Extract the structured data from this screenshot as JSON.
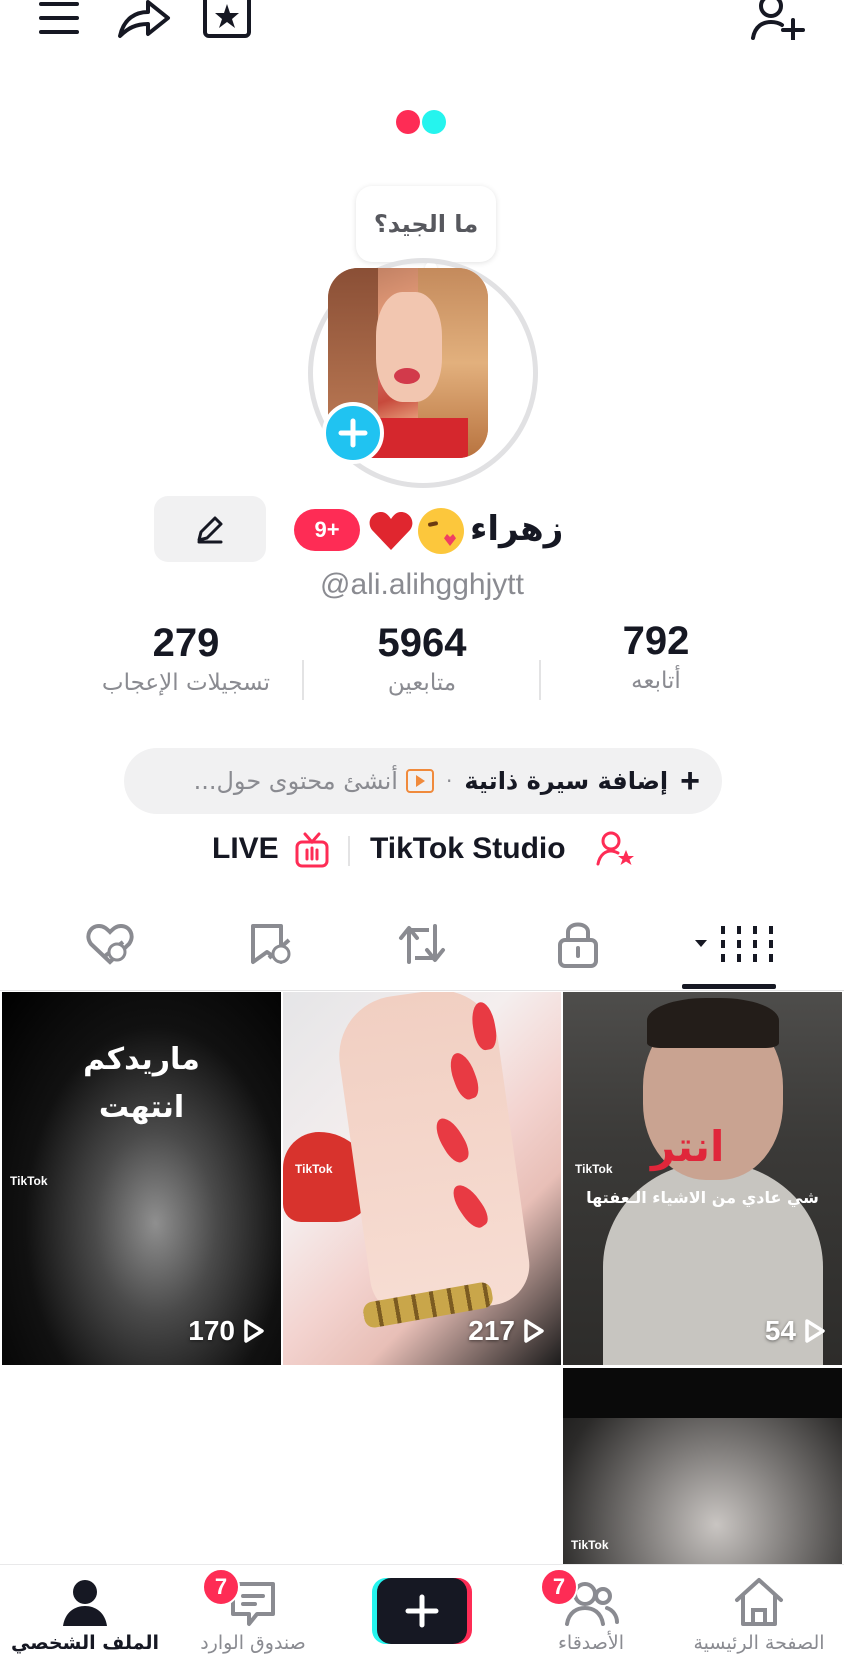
{
  "top_bar": {
    "menu_icon": "hamburger-menu-icon",
    "share_icon": "share-arrow-icon",
    "favorites_icon": "bookmark-star-icon",
    "add_friend_icon": "add-user-icon"
  },
  "profile": {
    "story_bubble": "ما الجيد؟",
    "display_name": "زهراء",
    "emoji_kiss": "kissing-face-emoji",
    "emoji_heart": "red-heart-emoji",
    "badge": "9+",
    "handle": "@ali.alihgghjytt"
  },
  "stats": [
    {
      "value": "792",
      "label": "أتابعه"
    },
    {
      "value": "5964",
      "label": "متابعين"
    },
    {
      "value": "279",
      "label": "تسجيلات الإعجاب"
    }
  ],
  "bio": {
    "add_bio": "إضافة سيرة ذاتية",
    "separator": "·",
    "create_prompt": "أنشئ محتوى حول..."
  },
  "links": {
    "live": "LIVE",
    "studio": "TikTok Studio"
  },
  "tabs": [
    {
      "name": "videos-grid-icon",
      "active": true
    },
    {
      "name": "lock-icon",
      "active": false
    },
    {
      "name": "repost-icon",
      "active": false
    },
    {
      "name": "favorites-hidden-icon",
      "active": false
    },
    {
      "name": "liked-hidden-icon",
      "active": false
    }
  ],
  "videos": [
    {
      "views": "217"
    },
    {
      "views": "54"
    },
    {
      "views": "170",
      "caption": "ماريدكم\nانتهت"
    }
  ],
  "video_captions": {
    "v1_line1": "ماريدكم",
    "v1_line2": "انتهت",
    "v3_red": "انتر",
    "v3_sub": "شي عادي من الاشياء الـعفتها",
    "tiktok_mark": "TikTok"
  },
  "bottom_nav": {
    "home": "الصفحة الرئيسية",
    "friends": "الأصدقاء",
    "friends_badge": "7",
    "inbox": "صندوق الوارد",
    "inbox_badge": "7",
    "profile": "الملف الشخصي"
  },
  "colors": {
    "accent_pink": "#fe2c55",
    "accent_cyan": "#25f4ee",
    "add_button_blue": "#20c3f1",
    "text_primary": "#161823",
    "text_secondary": "#8a8b91"
  }
}
